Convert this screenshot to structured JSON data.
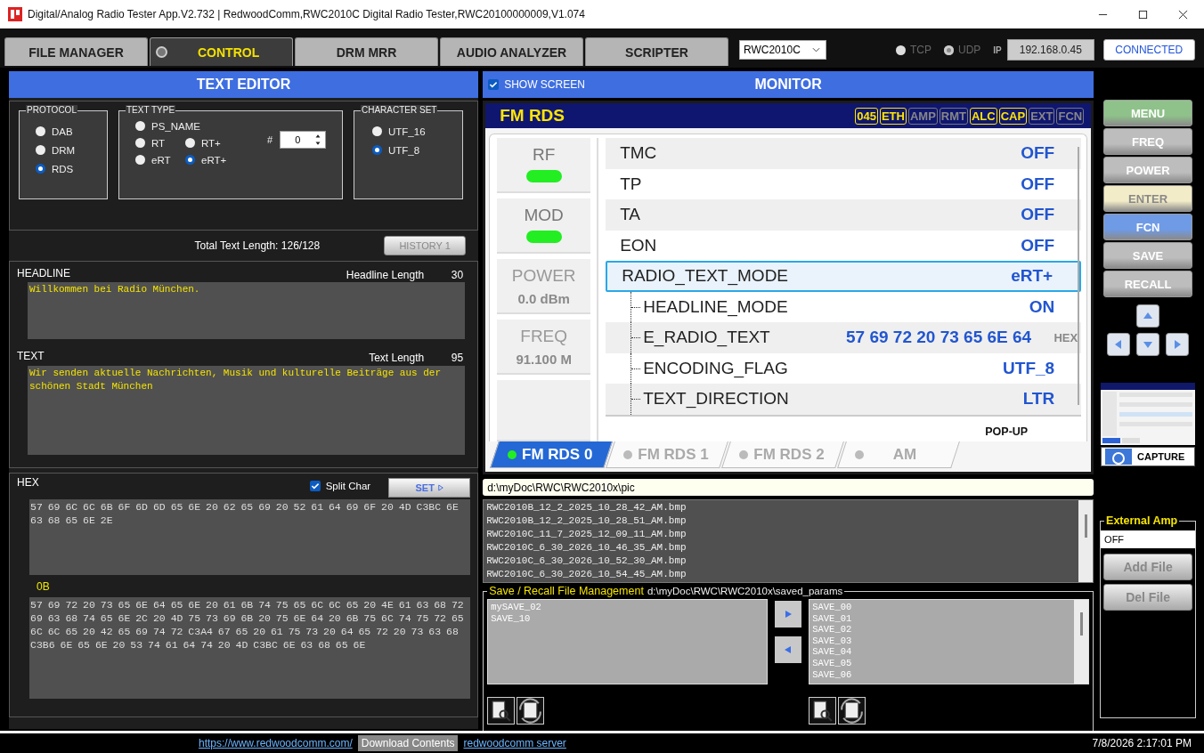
{
  "window": {
    "title": "Digital/Analog Radio Tester App.V2.732 | RedwoodComm,RWC2010C Digital Radio Tester,RWC20100000009,V1.074"
  },
  "tabs": [
    {
      "label": "FILE MANAGER",
      "selected": false
    },
    {
      "label": "CONTROL",
      "selected": true
    },
    {
      "label": "DRM MRR",
      "selected": false
    },
    {
      "label": "AUDIO ANALYZER",
      "selected": false
    },
    {
      "label": "SCRIPTER",
      "selected": false
    }
  ],
  "device_select": {
    "value": "RWC2010C"
  },
  "transport": [
    {
      "label": "TCP",
      "selected": false
    },
    {
      "label": "UDP",
      "selected": true
    }
  ],
  "ip": {
    "label": "IP",
    "value": "192.168.0.45"
  },
  "connection": {
    "label": "CONNECTED"
  },
  "text_editor": {
    "title": "TEXT EDITOR",
    "protocol": {
      "title": "PROTOCOL",
      "options": [
        {
          "label": "DAB",
          "selected": false
        },
        {
          "label": "DRM",
          "selected": false
        },
        {
          "label": "RDS",
          "selected": true
        }
      ]
    },
    "text_type": {
      "title": "TEXT TYPE",
      "options": [
        {
          "label": "PS_NAME",
          "selected": false
        },
        {
          "label": "RT",
          "selected": false
        },
        {
          "label": "RT+",
          "selected": false
        },
        {
          "label": "eRT",
          "selected": false
        },
        {
          "label": "eRT+",
          "selected": true
        }
      ]
    },
    "index": {
      "label": "#",
      "value": "0"
    },
    "character_set": {
      "title": "CHARACTER SET",
      "options": [
        {
          "label": "UTF_16",
          "selected": false
        },
        {
          "label": "UTF_8",
          "selected": true
        }
      ]
    },
    "total_length": "Total Text Length: 126/128",
    "history_button": "HISTORY 1",
    "headline": {
      "label": "HEADLINE",
      "length_label": "Headline Length",
      "length": "30",
      "value": "Willkommen bei Radio München."
    },
    "text": {
      "label": "TEXT",
      "length_label": "Text Length",
      "length": "95",
      "value": "Wir senden aktuelle Nachrichten, Musik und kulturelle Beiträge aus der schönen Stadt München"
    },
    "hex": {
      "label": "HEX",
      "split_char": {
        "label": "Split Char",
        "checked": true
      },
      "set_button": "SET",
      "headline_hex": "57 69 6C 6C 6B 6F 6D 6D 65 6E 20 62 65 69 20 52 61 64 69 6F 20 4D C3BC 6E 63 68 65 6E 2E",
      "marker": "0B",
      "text_hex": "57 69 72 20 73 65 6E 64 65 6E 20 61 6B 74 75 65 6C 6C 65 20 4E 61 63 68 72 69 63 68 74 65 6E 2C 20 4D 75 73 69 6B 20 75 6E 64 20 6B 75 6C 74 75 72 65 6C 6C 65 20 42 65 69 74 72 C3A4 67 65 20 61 75 73 20 64 65 72 20 73 63 68 C3B6 6E 65 6E 20 53 74 61 64 74 20 4D C3BC 6E 63 68 65 6E"
    }
  },
  "monitor": {
    "title": "MONITOR",
    "show_screen": {
      "label": "SHOW SCREEN",
      "checked": true
    },
    "screen": {
      "title": "FM RDS",
      "indicators": [
        {
          "label": "045",
          "on": true
        },
        {
          "label": "ETH",
          "on": true
        },
        {
          "label": "AMP",
          "on": false
        },
        {
          "label": "RMT",
          "on": false
        },
        {
          "label": "ALC",
          "on": true
        },
        {
          "label": "CAP",
          "on": true
        },
        {
          "label": "EXT",
          "on": false
        },
        {
          "label": "FCN",
          "on": false
        }
      ],
      "gauges": [
        {
          "label": "RF",
          "kind": "led",
          "on": true
        },
        {
          "label": "MOD",
          "kind": "led",
          "on": true
        },
        {
          "label": "POWER",
          "kind": "reading",
          "reading": "0.0 dBm"
        },
        {
          "label": "FREQ",
          "kind": "reading",
          "reading": "91.100 M"
        }
      ],
      "rows": [
        {
          "name": "TMC",
          "value": "OFF",
          "selected": false
        },
        {
          "name": "TP",
          "value": "OFF",
          "selected": false
        },
        {
          "name": "TA",
          "value": "OFF",
          "selected": false
        },
        {
          "name": "EON",
          "value": "OFF",
          "selected": false
        },
        {
          "name": "RADIO_TEXT_MODE",
          "value": "eRT+",
          "selected": true,
          "children": [
            {
              "name": "HEADLINE_MODE",
              "value": "ON",
              "selected": false
            },
            {
              "name": "E_RADIO_TEXT",
              "value": "57 69 72 20 73 65 6E 64",
              "unit": "HEX",
              "selected": false
            },
            {
              "name": "ENCODING_FLAG",
              "value": "UTF_8",
              "selected": false
            },
            {
              "name": "TEXT_DIRECTION",
              "value": "LTR",
              "selected": false
            }
          ]
        }
      ],
      "popup_label": "POP-UP",
      "tabs": [
        {
          "label": "FM RDS 0",
          "selected": true
        },
        {
          "label": "FM RDS 1",
          "selected": false
        },
        {
          "label": "FM RDS 2",
          "selected": false
        },
        {
          "label": "AM",
          "selected": false
        }
      ]
    },
    "path": "d:\\myDoc\\RWC\\RWC2010x\\pic",
    "files": [
      "RWC2010B_12_2_2025_10_28_42_AM.bmp",
      "RWC2010B_12_2_2025_10_28_51_AM.bmp",
      "RWC2010C_11_7_2025_12_09_11_AM.bmp",
      "RWC2010C_6_30_2026_10_46_35_AM.bmp",
      "RWC2010C_6_30_2026_10_52_30_AM.bmp",
      "RWC2010C_6_30_2026_10_54_45_AM.bmp"
    ],
    "save_recall": {
      "title": "Save / Recall File Management",
      "path": "d:\\myDoc\\RWC\\RWC2010x\\saved_params",
      "left_list": [
        "mySAVE_02",
        "SAVE_10"
      ],
      "right_list": [
        "SAVE_00",
        "SAVE_01",
        "SAVE_02",
        "SAVE_03",
        "SAVE_04",
        "SAVE_05",
        "SAVE_06"
      ]
    }
  },
  "side_buttons": [
    {
      "label": "MENU",
      "color": "#8fc28a"
    },
    {
      "label": "FREQ",
      "color": "#bdbdbd"
    },
    {
      "label": "POWER",
      "color": "#bdbdbd"
    },
    {
      "label": "ENTER",
      "color": "#f3ecc8"
    },
    {
      "label": "FCN",
      "color": "#6f9ae6"
    },
    {
      "label": "SAVE",
      "color": "#bdbdbd"
    },
    {
      "label": "RECALL",
      "color": "#bdbdbd"
    }
  ],
  "capture_button": "CAPTURE",
  "external_amp": {
    "title": "External Amp",
    "value": "OFF",
    "buttons": [
      "Add File",
      "Del File"
    ]
  },
  "footer": {
    "link": "https://www.redwoodcomm.com/",
    "download": "Download Contents",
    "server_link": "redwoodcomm server",
    "datetime": "7/8/2026 2:17:01 PM"
  }
}
